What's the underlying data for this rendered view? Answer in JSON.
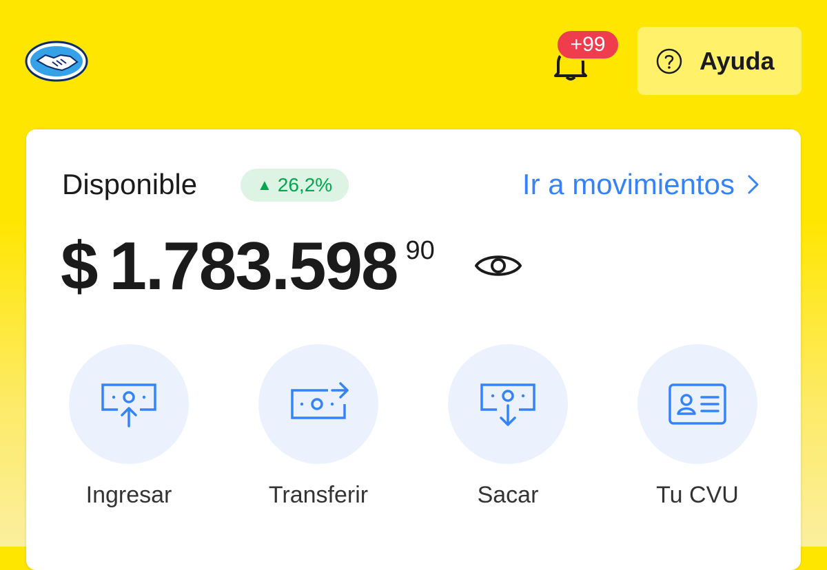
{
  "header": {
    "logo_icon": "handshake-logo-icon",
    "notifications": {
      "icon": "bell-icon",
      "badge": "+99",
      "badge_color": "#EF3D4E"
    },
    "help": {
      "icon": "question-circle-icon",
      "label": "Ayuda"
    },
    "brand_color": "#FFE600"
  },
  "balance_card": {
    "label": "Disponible",
    "change": {
      "arrow": "▲",
      "value": "26,2%",
      "color": "#00A650"
    },
    "movements_link": "Ir a movimientos",
    "currency": "$",
    "amount": "1.783.598",
    "cents": "90",
    "visibility_icon": "eye-icon",
    "link_color": "#3483FA"
  },
  "actions": [
    {
      "label": "Ingresar",
      "icon": "money-in-icon"
    },
    {
      "label": "Transferir",
      "icon": "money-transfer-icon"
    },
    {
      "label": "Sacar",
      "icon": "money-out-icon"
    },
    {
      "label": "Tu CVU",
      "icon": "id-card-icon"
    }
  ]
}
